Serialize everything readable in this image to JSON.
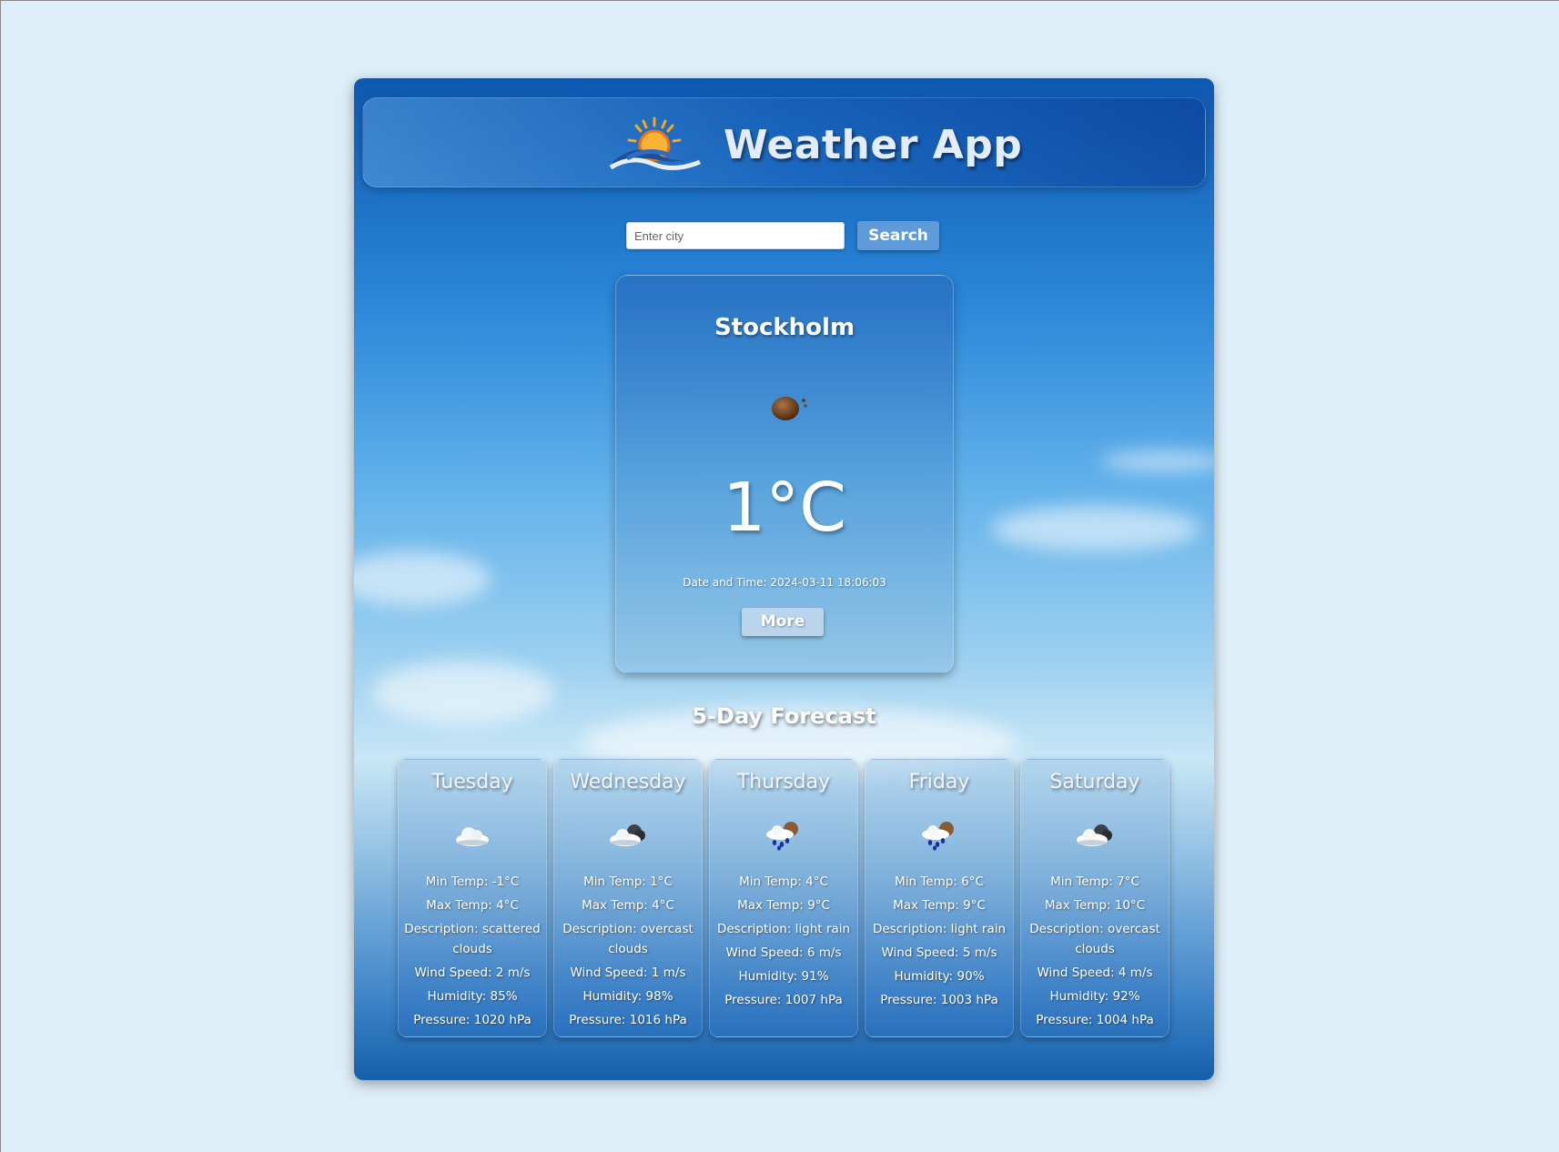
{
  "header": {
    "title": "Weather App",
    "logo_icon": "sun-over-waves-icon"
  },
  "search": {
    "placeholder": "Enter city",
    "value": "",
    "button_label": "Search"
  },
  "current": {
    "city": "Stockholm",
    "icon": "moon-clouds-icon",
    "temperature": "1°C",
    "datetime": "Date and Time: 2024-03-11 18:06:03",
    "more_label": "More"
  },
  "forecast": {
    "title": "5-Day Forecast",
    "days": [
      {
        "day": "Tuesday",
        "icon": "cloud-icon",
        "min": "Min Temp: -1°C",
        "max": "Max Temp: 4°C",
        "description": "Description: scattered clouds",
        "wind": "Wind Speed: 2 m/s",
        "humidity": "Humidity: 85%",
        "pressure": "Pressure: 1020 hPa"
      },
      {
        "day": "Wednesday",
        "icon": "overcast-clouds-icon",
        "min": "Min Temp: 1°C",
        "max": "Max Temp: 4°C",
        "description": "Description: overcast clouds",
        "wind": "Wind Speed: 1 m/s",
        "humidity": "Humidity: 98%",
        "pressure": "Pressure: 1016 hPa"
      },
      {
        "day": "Thursday",
        "icon": "light-rain-icon",
        "min": "Min Temp: 4°C",
        "max": "Max Temp: 9°C",
        "description": "Description: light rain",
        "wind": "Wind Speed: 6 m/s",
        "humidity": "Humidity: 91%",
        "pressure": "Pressure: 1007 hPa"
      },
      {
        "day": "Friday",
        "icon": "light-rain-icon",
        "min": "Min Temp: 6°C",
        "max": "Max Temp: 9°C",
        "description": "Description: light rain",
        "wind": "Wind Speed: 5 m/s",
        "humidity": "Humidity: 90%",
        "pressure": "Pressure: 1003 hPa"
      },
      {
        "day": "Saturday",
        "icon": "overcast-clouds-icon",
        "min": "Min Temp: 7°C",
        "max": "Max Temp: 10°C",
        "description": "Description: overcast clouds",
        "wind": "Wind Speed: 4 m/s",
        "humidity": "Humidity: 92%",
        "pressure": "Pressure: 1004 hPa"
      }
    ]
  },
  "colors": {
    "page_background": "#deeef8",
    "panel_top": "#0e58b0",
    "button": "#5e9bd8"
  }
}
